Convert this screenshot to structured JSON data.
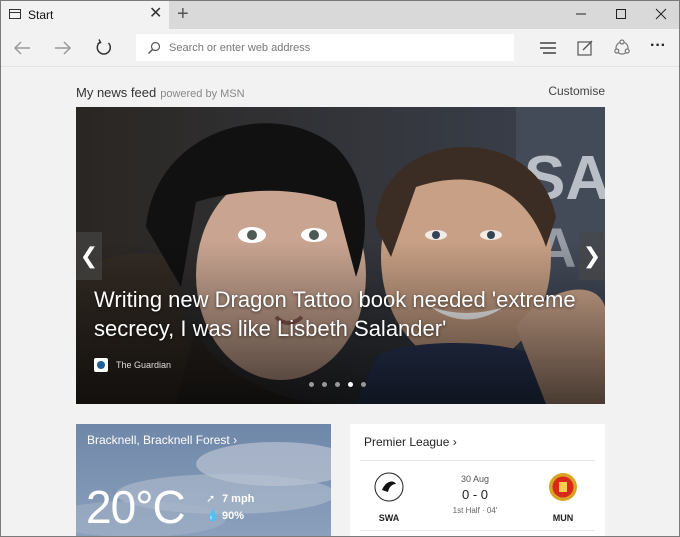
{
  "tab": {
    "title": "Start",
    "close_symbol": "✕",
    "new_tab_symbol": "+"
  },
  "window_controls": {
    "minimize": "—",
    "maximize": "☐",
    "close": "✕"
  },
  "toolbar": {
    "address_placeholder": "Search or enter web address",
    "more_symbol": "···"
  },
  "feed": {
    "title": "My news feed",
    "powered_by": "powered by MSN",
    "customise": "Customise"
  },
  "hero": {
    "headline": "Writing new Dragon Tattoo book needed 'extreme secrecy, I was like Lisbeth Salander'",
    "source": "The Guardian",
    "prev_symbol": "❮",
    "next_symbol": "❯",
    "slide_count": 5,
    "active_slide": 4
  },
  "weather": {
    "location": "Bracknell, Bracknell Forest",
    "temperature": "20°C",
    "wind": "7 mph",
    "humidity": "90%"
  },
  "sports": {
    "league": "Premier League",
    "home_team": "SWA",
    "away_team": "MUN",
    "date": "30 Aug",
    "score": "0 - 0",
    "status": "1st Half · 04'"
  },
  "icons": {
    "tab": "tab-page-icon",
    "back": "back-arrow-icon",
    "forward": "forward-arrow-icon",
    "refresh": "refresh-icon",
    "search": "search-icon",
    "hub": "hub-icon",
    "note": "web-note-icon",
    "share": "share-icon",
    "more": "more-icon"
  }
}
